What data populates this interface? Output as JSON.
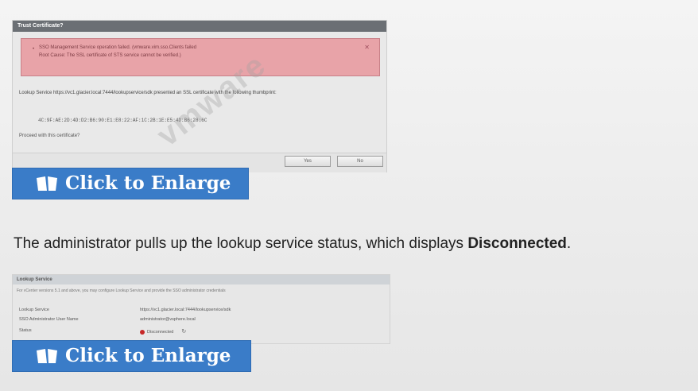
{
  "dialog1": {
    "title": "Trust Certificate?",
    "error_line1": "SSO Management Service operation failed. (vmware.vim.sso.Clients failed",
    "error_line2": "Root Cause: The SSL certificate of STS service cannot be verified.)",
    "message": "Lookup Service https://vc1.glacier.local:7444/lookupservice/sdk presented an SSL certificate with the following thumbprint:",
    "thumbprint": "4C:9F:AE:2D:4D:D2:B6:90:E1:E8:22:AF:1C:2B:1E:E5:4D:B6:28:6C",
    "proceed": "Proceed with this certificate?",
    "yes_label": "Yes",
    "no_label": "No",
    "watermark": "vmware"
  },
  "enlarge_top": {
    "label": "Click to Enlarge"
  },
  "sentence": {
    "prefix": "The administrator pulls up the lookup service status, which displays ",
    "emphasis": "Disconnected",
    "suffix": "."
  },
  "lookup_panel": {
    "title": "Lookup Service",
    "note": "For vCenter versions 5.1 and above, you may configure Lookup Service and provide the SSO administrator credentials",
    "rows": [
      {
        "key": "Lookup Service",
        "value": "https://vc1.glacier.local:7444/lookupservice/sdk"
      },
      {
        "key": "SSO Administrator User Name",
        "value": "administrator@vsphere.local"
      },
      {
        "key": "Status",
        "value": "Disconnected"
      }
    ]
  },
  "enlarge_bottom": {
    "label": "Click to Enlarge"
  },
  "colors": {
    "enlarge_button": "#3a7cc8",
    "error_background": "#e8a3a8",
    "status_disconnected": "#c62828"
  },
  "icons": {
    "enlarge": "book-icon",
    "error_close": "close-icon",
    "status": "status-dot-icon",
    "refresh": "refresh-icon"
  }
}
